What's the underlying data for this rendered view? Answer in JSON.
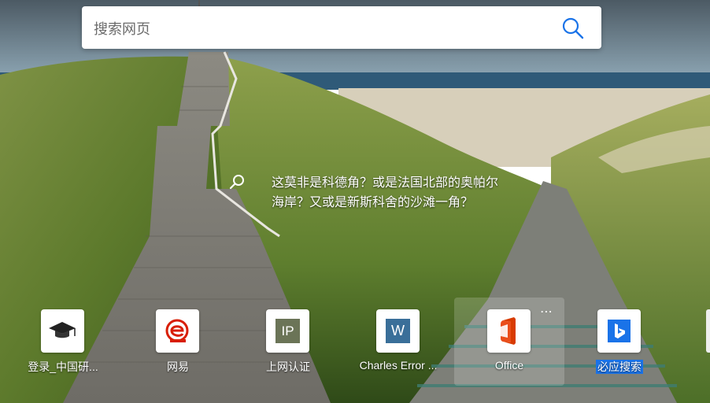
{
  "search": {
    "placeholder": "搜索网页"
  },
  "caption": {
    "line1": "这莫非是科德角？或是法国北部的奥帕尔",
    "line2": "海岸？又或是新斯科舍的沙滩一角？"
  },
  "tiles": [
    {
      "label": "登录_中国研...",
      "icon": "graduation-cap-icon"
    },
    {
      "label": "网易",
      "icon": "netease-logo-icon"
    },
    {
      "label": "上网认证",
      "icon": "ip-icon",
      "glyph": "IP"
    },
    {
      "label": "Charles Error ...",
      "icon": "word-icon",
      "glyph": "W"
    },
    {
      "label": "Office",
      "icon": "office-icon",
      "more": "⋯"
    },
    {
      "label": "必应搜索",
      "icon": "bing-icon"
    }
  ],
  "colors": {
    "accent": "#1a73e8",
    "search_icon": "#1a73e8"
  }
}
